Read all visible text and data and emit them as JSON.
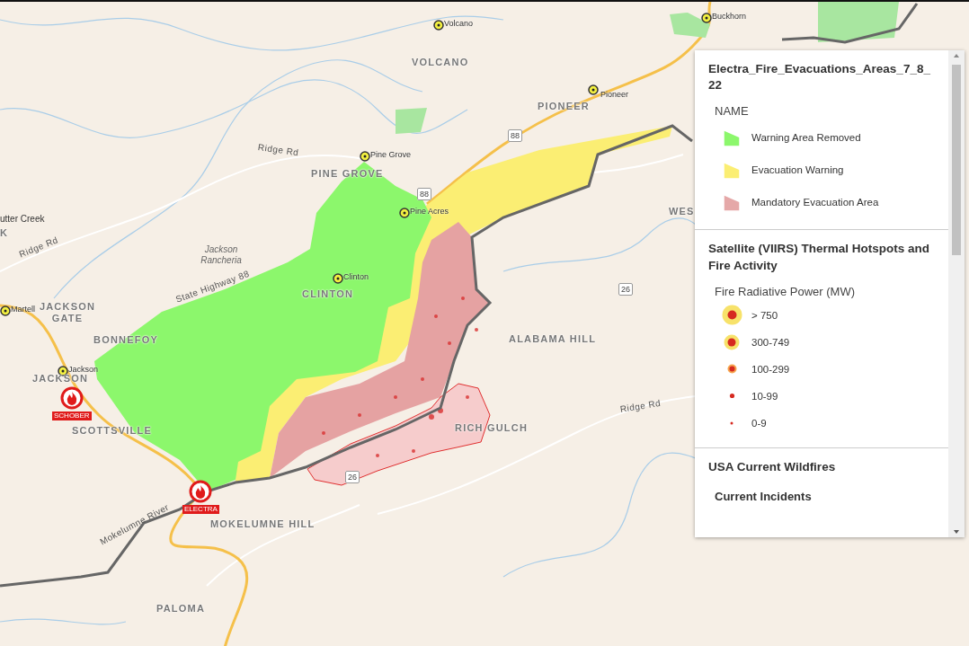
{
  "map": {
    "places": [
      {
        "kind": "town",
        "text": "Buckhorn"
      },
      {
        "kind": "town",
        "text": "Volcano"
      },
      {
        "kind": "area",
        "text": "VOLCANO"
      },
      {
        "kind": "town",
        "text": "Pioneer"
      },
      {
        "kind": "area",
        "text": "PIONEER"
      },
      {
        "kind": "town",
        "text": "Pine Grove"
      },
      {
        "kind": "area",
        "text": "PINE GROVE"
      },
      {
        "kind": "town",
        "text": "Pine Acres"
      },
      {
        "kind": "label",
        "text": "utter Creek"
      },
      {
        "kind": "area",
        "text": "K"
      },
      {
        "kind": "road",
        "text": "Ridge Rd"
      },
      {
        "kind": "road",
        "text": "Ridge Rd"
      },
      {
        "kind": "reservation",
        "text": "Jackson Rancheria"
      },
      {
        "kind": "town",
        "text": "Clinton"
      },
      {
        "kind": "area",
        "text": "CLINTON"
      },
      {
        "kind": "town",
        "text": "Martell"
      },
      {
        "kind": "area",
        "text": "JACKSON GATE"
      },
      {
        "kind": "area",
        "text": "BONNEFOY"
      },
      {
        "kind": "road",
        "text": "State Highway 88"
      },
      {
        "kind": "town",
        "text": "Jackson"
      },
      {
        "kind": "area",
        "text": "JACKSON"
      },
      {
        "kind": "fire",
        "text": "SCHOBER"
      },
      {
        "kind": "area",
        "text": "SCOTTSVILLE"
      },
      {
        "kind": "area",
        "text": "ALABAMA HILL"
      },
      {
        "kind": "road",
        "text": "Ridge Rd"
      },
      {
        "kind": "area",
        "text": "RICH GULCH"
      },
      {
        "kind": "shield",
        "text": "88"
      },
      {
        "kind": "shield",
        "text": "88"
      },
      {
        "kind": "shield",
        "text": "26"
      },
      {
        "kind": "shield",
        "text": "26"
      },
      {
        "kind": "fire",
        "text": "ELECTRA"
      },
      {
        "kind": "area",
        "text": "MOKELUMNE HILL"
      },
      {
        "kind": "road",
        "text": "Mokelumne River"
      },
      {
        "kind": "area",
        "text": "PALOMA"
      },
      {
        "kind": "area",
        "text": "WES"
      }
    ]
  },
  "legend": {
    "sections": [
      {
        "title": "Electra_Fire_Evacuations_Areas_7_8_22",
        "subtitle": "NAME",
        "items": [
          {
            "kind": "polygon",
            "label": "Warning Area Removed",
            "color": "#8cf76c"
          },
          {
            "kind": "polygon",
            "label": "Evacuation Warning",
            "color": "#fbee73"
          },
          {
            "kind": "polygon",
            "label": "Mandatory Evacuation Area",
            "color": "#e5a8a8"
          }
        ]
      },
      {
        "title": "Satellite (VIIRS) Thermal Hotspots and Fire Activity",
        "subtitle": "Fire Radiative Power (MW)",
        "items": [
          {
            "kind": "point",
            "label": "> 750"
          },
          {
            "kind": "point",
            "label": "300-749"
          },
          {
            "kind": "point",
            "label": "100-299"
          },
          {
            "kind": "point",
            "label": "10-99"
          },
          {
            "kind": "point",
            "label": "0-9"
          }
        ]
      },
      {
        "title": "USA Current Wildfires",
        "subtitle": "Current Incidents"
      }
    ]
  }
}
